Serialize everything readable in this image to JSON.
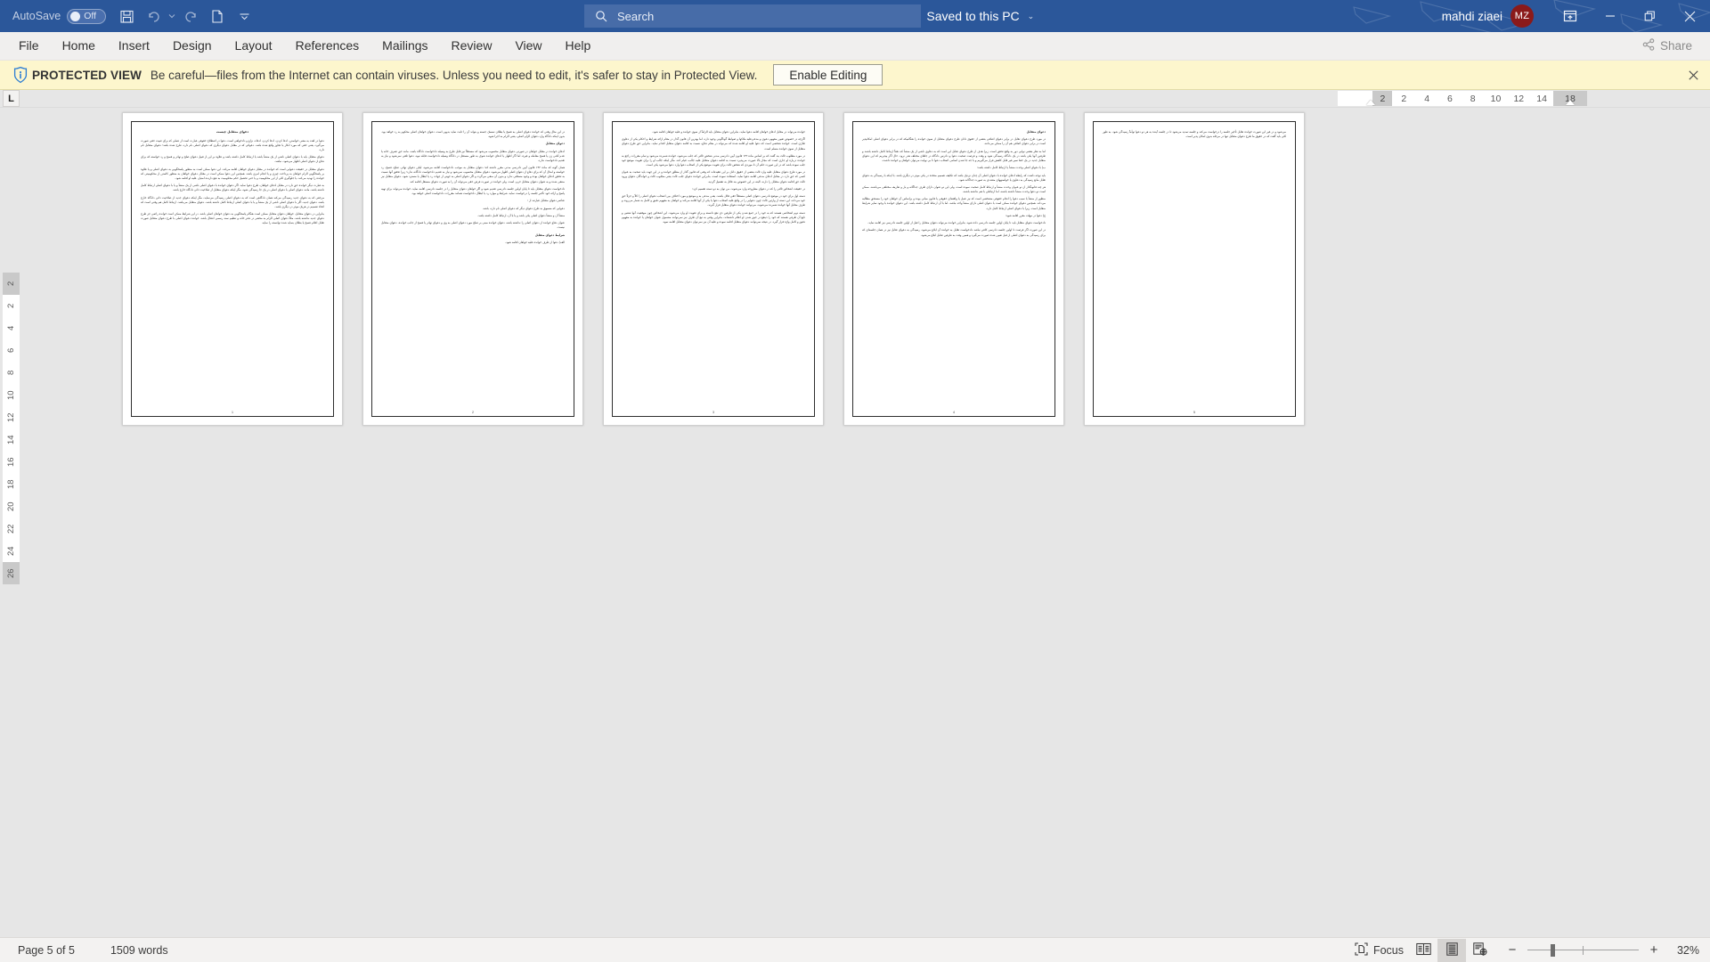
{
  "titlebar": {
    "autosave_label": "AutoSave",
    "autosave_state": "Off",
    "quick_access": [
      "save-icon",
      "undo-icon",
      "undo-dropdown-icon",
      "redo-icon",
      "new-icon",
      "customize-qat-icon"
    ],
    "document_title": "دعوای متقابل چیست",
    "separator1": "-",
    "protected_view_label": "Protected View",
    "separator2": "-",
    "save_location": "Saved to this PC",
    "dropdown_caret": "⌄",
    "search_placeholder": "Search",
    "search_icon": "search-icon",
    "username": "mahdi ziaei",
    "avatar_initials": "MZ",
    "avatar_color": "#8b1a1a",
    "ribbon_display_icon": "ribbon-display-options-icon",
    "minimize": "—",
    "restore": "❐",
    "close": "✕",
    "bg_color": "#2b579a"
  },
  "ribbon": {
    "tabs": [
      {
        "label": "File"
      },
      {
        "label": "Home"
      },
      {
        "label": "Insert"
      },
      {
        "label": "Design"
      },
      {
        "label": "Layout"
      },
      {
        "label": "References"
      },
      {
        "label": "Mailings"
      },
      {
        "label": "Review"
      },
      {
        "label": "View"
      },
      {
        "label": "Help"
      }
    ],
    "share_label": "Share",
    "share_icon": "share-icon"
  },
  "protected_view": {
    "icon": "info-shield-icon",
    "title": "PROTECTED VIEW",
    "message": "Be careful—files from the Internet can contain viruses. Unless you need to edit, it's safer to stay in Protected View.",
    "enable_button": "Enable Editing",
    "close_icon": "close-icon",
    "bg_color": "#fdf6cd"
  },
  "ruler": {
    "tab_selector_glyph": "L",
    "horizontal_left_margin": "18",
    "horizontal_ticks": [
      "14",
      "12",
      "10",
      "8",
      "6",
      "4",
      "2"
    ],
    "horizontal_right_margin": "2",
    "vertical_top_margin": "2",
    "vertical_ticks": [
      "2",
      "4",
      "6",
      "8",
      "10",
      "12",
      "14",
      "16",
      "18",
      "20",
      "22",
      "24"
    ],
    "vertical_bottom_margin": "26"
  },
  "document": {
    "pages": [
      {
        "number": "1",
        "paragraphs": [
          {
            "style": "heading",
            "text": "دعوای متقابل چیست"
          },
          {
            "style": "body",
            "text": "دعوا در لغت به معنی خواستن، ادعا کردن، ادعا کردن، ادعاء، نزاع و دادخواهی است. دعوا در اصطلاح حقوقی عبارت است از عملی که برای تثبیت حقی صورت می‌گیرد، یعنی حقی که مورد انکار یا تجاوز واقع شده باشد. دعوائی که در مقابل دعوای دیگری که دعوای اصلی نام دارد، طرح شده باشد؛ دعوای متقابل نام دارد."
          },
          {
            "style": "body",
            "text": "دعوای متقابل باید با دعوای اصلی ناشی از یک منشأ باشد یا ارتباط کامل داشته باشد و علاوه بر این از قبیل دعوای صلح و تهاتر و فسخ و رد خواسته که برای دفاع از دعوای اصلی اظهار می‌شود، نباشد."
          },
          {
            "style": "body",
            "text": "دعوای متقابل در حقیقت دعوایی است که خوانده در مقابل دعوای خواهان اقامه می‌کند. این دعوا ممکن است به منظور پاسخگویی به دعوای اصلی و یا علاوه بر پاسخگویی الزام خواهان به پرداخت چیزی و یا انجام امری باشد. همچنین این دعوا ممکن است در مقابل دعوای خواهان به منظور کاستن از محکومیتی که خوانده را تهدید می‌کند، یا جلوگیری کلی از این محکومیت و یا حتی تحصیل حکم محکومیت به نفع دارنده امتیاز، علیه او اقامه شود."
          },
          {
            "style": "body",
            "text": "به عبارت دیگر خوانده حق دارد در مقابل ادعای خواهان، طرح دعوا نماید. اگر دعوای خوانده با دعوای اصلی ناشی از یک منشأ و یا با دعوای اصلی ارتباط کامل داشته باشد، مانند دعوای اصلی با دعوای اصلی در یک جا رسیدگی شود، مگر اینکه دعوای متقابل از صلاحیت ذاتی دادگاه خارج باشد."
          },
          {
            "style": "body",
            "text": "مرجعی که به دعوای جدید رسیدگی می‌کند همان دادگاهی است که به دعوای اصلی رسیدگی می‌نماید، مگر اینکه دعوای جدید از صلاحیت ذاتی دادگاه خارج باشد. دعوای جدید، اگر با دعوای اصلی ناشی از یک منشأ و یا با دعوای اصلی ارتباط کامل داشته باشد، دعوای متقابل می‌باشد. ارتباط کامل هم وقتی است که اتخاذ تصمیم در هریک موثر در دیگری باشد."
          },
          {
            "style": "body",
            "text": "بنابراین در دعوای متقابل، خواهان دعوای متقابل ممکن است هنگام پاسخگویی به دعوای خواهان اصلی باشد. در این شرایط ممکن است خوانده راضی جز طرح دعوای جدید نداشته باشد، مثلاً دعوای اصلی الزام به محضر در دفتر خانه و تنظیم سند رسمی انتقال باشد، خوانده دعوای اصلی با طرح دعوای متقابل صورت تقابل اعلام فسخ یا بطلان بنماید شده توانسته را نماید."
          }
        ]
      },
      {
        "number": "2",
        "paragraphs": [
          {
            "style": "body",
            "text": "در این مثال وقتی که خوانده دعوای اصلی به فسخ یا بطلان تمسک جسته و بتواند آن را ثابت نماید بدیهی است، دعوای خواهان اصلی محکوم به رد خواهد بود. بدون اینکه دادگاه وارد دعوای الزام اصلی، یعنی الزام به اجرا شود."
          },
          {
            "style": "sub",
            "text": "دعوای متقابل"
          },
          {
            "style": "body",
            "text": "ادعای خوانده در مقابل خواهان در صورتی دعوای متقابل محسوب می‌شود که مستقلاً نیز قابل طرح به وسیله دادخواست دادگاه باشد، مانند حق تصرف خانه یا عدم لکنی زن یا فسخ معامله و غیره. اما اگر اظهار یا ادعای خوانده شوک به طور مستقل در دادگاه وسیله دادخواست قابله نبود، دعوا تلقی نمی‌شود و نیاز به تقدیم دادخواست ندارد."
          },
          {
            "style": "body",
            "text": "همان گونه که ماده ۱۴۲ قانون آیین دادرسی مدنی مقرر داشته که؛ دعوای متقابل به موجب دادخواست اقامه می‌شود، لیکن دعوای تهاتر، صلح، فسخ، رد خواسته و امثال آن که برای دفاع از دعوای اصلی اظهار می‌شود، دعوای متقابل محسوب نمی‌شود و نیاز به تقدیم دادخواست دادگانه ندارد؛ زیرا تحقق آنها نسبت به تحقق ادعای خواهان بوده و وجود مسئلتی ندارد و بدون آن منفی می‌گردد و اگر دعوای اصلی به جهتی از جهات رد یا ابطال یا مسترد شود، دعوای متقابل نیز منتفی شده و به عنوان دعوای متقابل حرم، است. ولی خوانده در صورت فرض حقی می‌تواند آن را به صورت دعوای مستقل اقامه کند."
          },
          {
            "style": "body",
            "text": "دادخواست دعوای متقابل باید تا پایان اولین جلسه دادرسی تقدیم شود و اگر خواهان دعوای متقابل را در جلسه دادرسی اقامه نماید، خوانده می‌تواند برای تهیه پاسخ و ارائه خود تأخیر جلسه را درخواست نماید. شرایط و موارد رد یا ابطال دادخواست همانند مقررات دادخواست اصلی خواهد بود."
          },
          {
            "style": "body",
            "text": "عناصر دعوای متقابل عبارتند از :"
          },
          {
            "style": "body",
            "text": "دعوایی که مسبوق به طرح دعوای دیگر که دعوای اصلی نام دارد، باشد."
          },
          {
            "style": "body",
            "text": "منشأ آن و منشأ دعوای اصلی یکی باشد و یا با آن، ارتباط کامل داشته باشد."
          },
          {
            "style": "body",
            "text": "عنوان دفاع خوانده از دعوای اصلی را نداشته باشد، دعوای خوانده مبنی بر صلح مورد دعوای اصلی به وی و دعوای تهاتر یا فسخ از جانب خوانده، دعوای متقابل نیست."
          },
          {
            "style": "sub",
            "text": "شرایط دعوای متقابل"
          },
          {
            "style": "body",
            "text": "الف) دعوا از طرف خوانده علیه خواهان اقامه شود."
          }
        ]
      },
      {
        "number": "3",
        "paragraphs": [
          {
            "style": "body",
            "text": "خوانده می‌تواند در مقابل ادعای خواهان اقامه دعوا نماید، بنابراین دعوای متقابل باید الزاماً از سوی خوانده و علیه خواهان اقامه شود."
          },
          {
            "style": "body",
            "text": "اگرچه در خصوص تعیین مفهوم دعوی و مدعی‌علیه ملاکها و ضوابط گوناگونی وجود دارد، اما بهترین آن قانون گذار در مقام ارائه شرایط و احکام یکی از دعاوی طاری است. خوانده شخصی است که دعوا علیه او اقامه شده که می‌تواند در مقام دفاع، نسبت به اقامه دعوای متقابل اقدام نماید. بنابراین حق طرح دعوای متقابل از سوی خوانده مسلم است."
          },
          {
            "style": "body",
            "text": "در مورد مطلوب ثالث بند گفت که بر اساس ماده ۱۴۲ قانون آیین دادرسی مدنی شخص ثالثی که جلب می‌شود، خوانده شمرده می‌شود و تمام مقررات راجع به خوانده درباره او جاری است که مجاز بالا صورت می‌پذیرد نسبت به اقامه دعوای متقابل علیه جالب، قیام کند. مگر اینکه جالب او را برای تقویت موضع خود جلب نموده باشد که در این صورت حکم آن تا موردی که شخص ثالث برای تقویت موضع یکی از اصحاب دعوا وارد دعوا می‌شود یکی است."
          },
          {
            "style": "body",
            "text": "در مورد طرح دعوای متقابل علیه وارد ثالث بعضی از حقوق دانان بر این عقیده‌اند که وقتی که قانون گذار از مطلق خوانده و در این جهت باید صحبت به عنوان کسی که حق دارد در مقابل ادعای مدعی اقامه دعوا نماید، استفاده نموده است. بنابراین خوانده دعوای جلب ثالث یعنی مجلوب ثالث و خواندگان دعوای ورود ثالث حق اقامه دعوای متقابل را دارند. البته در این خصوص بند قائل به تفصیل گردید."
          },
          {
            "style": "body",
            "text": "در حقیقت اشخاص ثالثی را که در دعوای مطروحه وارد می‌شوند، من توان به دو دسته تقسیم کرد:"
          },
          {
            "style": "body",
            "text": "دسته اول برای خود در موضع دادرسی دعوای اصلی مستقلاً حقی قائل باشند. یعنی مدعی به و موضع و مورد اختلاف بین اصحاب دعوای اصلی را کلاً و جزئاً حق خود می‌داند، این دسته از وارثین ثالث چون دعوایی را در واقع علیه اصحاب دعوا یا یکی از آنها اقامه می‌کند و خواهان به مفهوم دقیق و کامل به شمار می‌روند و طرف مقابل آنها خوانده شمرده می‌شوند، می‌توانند خوانده دعوای متقابل قرار گیرند."
          },
          {
            "style": "body",
            "text": "دسته دوم اشخاصی هستند که به خود را در جمع شدن یکی از طرفین ذی نفع دانسته و برای تقویت او وارد می‌شوند. این اشخاص چون موقعیت آنها شعبی و تابع آن طرفی هستند که خود را ذینفع در حیق شدن او اعلام داشته‌اند، بنابراین وقتی به تبع آن طرف نیز نمی‌توانند مشمول عنوان خواهان یا خوانده به مفهوم دقیق و کامل واژه قرار گیرد. در نتیجه نمی‌توانند دعوای متقابل اقامه نموده و علیه آن نیز نمی‌توان دعوای متقابل اقامه نمود."
          }
        ]
      },
      {
        "number": "4",
        "paragraphs": [
          {
            "style": "sub",
            "text": "دعوای متقابل"
          },
          {
            "style": "body",
            "text": "در مورد طرح دعوای تقابل در برابر دعوای اضافی بعضی از حقوق دانان طرح دعوای متقابل از سوی خوانده را هنگامیکه که در برابر دعوای اصلی امکانپذیر است در برابر دعوای اضافی هم آن را ممکن می‌دانند."
          },
          {
            "style": "body",
            "text": "اما به نظر بعضی نوایی دور به واقع تحقق است، زیرا هدف از طرح دعوای تقابل این است که به دعاوی ناشی از یک منشأ که دفعاً ارتباط کامل داشته باشند و طرفین آنها یکی باشد در یک دادگاه رسیدگی شود و وقت و فرصت صحبت دعوا و دادرس دادگاه در جاهای مختلف هدر نرود. حال اگر بپذیریم که این دعوای متقابل جدید در یک خط سیر غیر قابل کاهش قرار می‌گیریم و با جه جا شدن اسامی اصحاب دعوا تا بی نهایت می‌توان خواهان و خوانده داشت."
          },
          {
            "style": "body",
            "text": "ب) با دعوای اصلی وحدت منشأ یا ارتباط کامل داشته باشد:"
          },
          {
            "style": "body",
            "text": "باید توجه داشت که رابطه ادعای خوانده با دعوای اصلی آن چنان نزدیک باشد که تکلیف تصمیم متخذه در یکی موثر در دیگری باشد. با اینکه با رسیدگی به دعوای تقابل مانع رسیدگی به دعاوی یا خواستههای متعددی به صورت جداگانه شود."
          },
          {
            "style": "body",
            "text": "هر چند قانونگذار از دو عنوان وحدت منشأ و ارتباط کامل صحبت نموده است، ولی این دو عنوان دارای ظرف جداگانه و بار و تعاریف مختلفی می‌باشند. ممکن است دو دعوا وحدت منشأ داشته باشند، اما ارتباطی با هم نداشته باشند."
          },
          {
            "style": "body",
            "text": "منظور از منشأ با سبب دعوا را انجام حقوقی مشخصی است که نیز عمل یا واقعه‌ای حقوقی یا قانون مبانی بوده و براساس آن خواهان خود را مستحق مطالبه می‌داند. همچنین دعوای خوانده ممکن است با دعوای اصلی دارای منشأ واحد نباشد، اما با آن ارتباط کامل داشته باشد. این دعوای خوانده با وجود سایر شرایط متقابل است. زیرا با دعوای اصلی ارتباط کامل دارد."
          },
          {
            "style": "body",
            "text": "ج) دعوا در مهلت مقرر اقامه شود:"
          },
          {
            "style": "body",
            "text": "دادخواست دعوای متقابل باید تا پایان اولین جلسه دادرسی داده شود. بنابراین خوانده می‌تواند دعوای متقابل را قبل از اولین جلسه دادرسی نیز اقامه نماید."
          },
          {
            "style": "body",
            "text": "در این صورت اگر فرصت تا اولین جلسه دادرسی کافی نباشد دادخواست تقابل به خوانده آن ابلاغ می‌شود. رسیدگی به دعوای تقابل نیز در همان جلسه‌ای که برای رسیدگی به دعوای اصلی از قبل تعیین شده صورت می‌گیرد و همین وقت به طرفین تقابل ابلاغ می‌شود."
          }
        ]
      },
      {
        "number": "5",
        "paragraphs": [
          {
            "style": "body",
            "text": "می‌شود و در غیر این صورت خوانده تقابل تأخیر جلسه را درخواست می‌کند و جلسه تمدید می‌شود تا در جلسه آینده به هر دو دعوا توأماً رسیدگی شود. به طور کلی باید گفت که در حقوق ما طرح دعوای متقابل تنها در مرحله بدوی امکان پذیر است."
          }
        ]
      }
    ]
  },
  "statusbar": {
    "page_info": "Page 5 of 5",
    "word_count": "1509 words",
    "focus_label": "Focus",
    "focus_icon": "focus-icon",
    "read_mode_icon": "read-mode-icon",
    "print_layout_icon": "print-layout-icon",
    "web_layout_icon": "web-layout-icon",
    "zoom_out": "−",
    "zoom_in": "+",
    "zoom_percent": "32%"
  }
}
